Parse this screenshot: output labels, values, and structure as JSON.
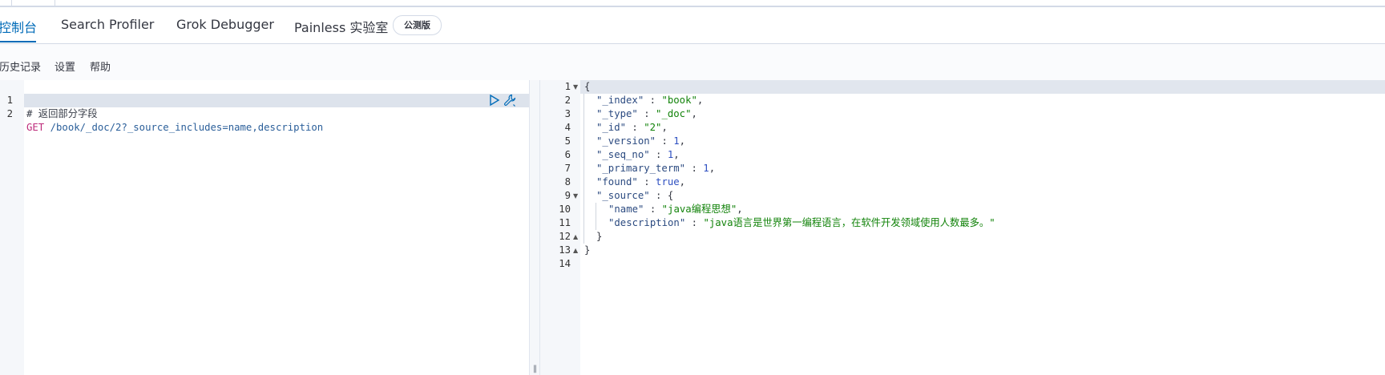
{
  "tabs": [
    {
      "label": "控制台",
      "active": true
    },
    {
      "label": "Search Profiler",
      "active": false
    },
    {
      "label": "Grok Debugger",
      "active": false
    },
    {
      "label": "Painless 实验室",
      "active": false
    }
  ],
  "badge": "公测版",
  "menu": [
    "历史记录",
    "设置",
    "帮助"
  ],
  "request": {
    "lines": [
      {
        "n": "1",
        "comment": "# 返回部分字段"
      },
      {
        "n": "2",
        "method": "GET",
        "url": " /book/_doc/2?_source_includes=name,description"
      }
    ],
    "icons": [
      "play-icon",
      "wrench-icon"
    ]
  },
  "response": {
    "line_numbers": [
      "1",
      "2",
      "3",
      "4",
      "5",
      "6",
      "7",
      "8",
      "9",
      "10",
      "11",
      "12",
      "13",
      "14"
    ],
    "open_brace": "{",
    "index_key": "\"_index\"",
    "index_val": "\"book\"",
    "type_key": "\"_type\"",
    "type_val": "\"_doc\"",
    "id_key": "\"_id\"",
    "id_val": "\"2\"",
    "version_key": "\"_version\"",
    "version_val": "1",
    "seq_key": "\"_seq_no\"",
    "seq_val": "1",
    "term_key": "\"_primary_term\"",
    "term_val": "1",
    "found_key": "\"found\"",
    "found_val": "true",
    "source_key": "\"_source\"",
    "name_key": "\"name\"",
    "name_val": "\"java编程思想\"",
    "desc_key": "\"description\"",
    "desc_val": "\"java语言是世界第一编程语言，在软件开发领域使用人数最多。\"",
    "close_inner": "}",
    "close_outer": "}"
  },
  "colors": {
    "accent": "#006bb8",
    "method": "#bd2b7b",
    "string": "#12830a",
    "number": "#2d4fc1"
  }
}
